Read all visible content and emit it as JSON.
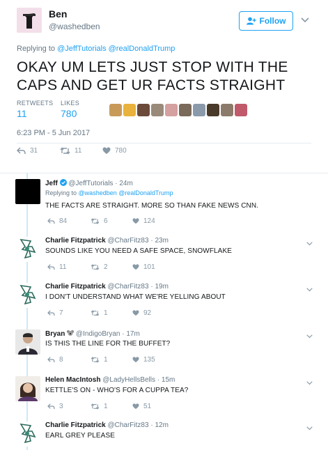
{
  "main_tweet": {
    "name": "Ben",
    "handle": "@washedben",
    "follow_label": "Follow",
    "replying_prefix": "Replying to",
    "replying_to": "@JeffTutorials @realDonaldTrump",
    "text": "OKAY UM LETS JUST STOP WITH THE CAPS AND GET UR FACTS STRAIGHT",
    "retweets_label": "RETWEETS",
    "retweets_count": "11",
    "likes_label": "LIKES",
    "likes_count": "780",
    "timestamp": "6:23 PM - 5 Jun 2017",
    "action_reply_count": "31",
    "action_retweet_count": "11",
    "action_like_count": "780",
    "liker_colors": [
      "#c89a5a",
      "#e9b23c",
      "#6b4a3a",
      "#9a8a7a",
      "#d4a0a0",
      "#7a6a5a",
      "#8a9aaa",
      "#4a3a2a",
      "#8c7b6a",
      "#c05a6a"
    ]
  },
  "replies": [
    {
      "name": "Jeff",
      "verified": true,
      "handle": "@JeffTutorials",
      "time": "24m",
      "replying_prefix": "Replying to",
      "replying_to": "@washedben @realDonaldTrump",
      "text": "THE FACTS ARE STRAIGHT. MORE SO THAN FAKE NEWS CNN.",
      "reply_count": "84",
      "retweet_count": "6",
      "like_count": "124"
    },
    {
      "name": "Charlie Fitzpatrick",
      "handle": "@CharFitz83",
      "time": "23m",
      "text": "SOUNDS LIKE YOU NEED A SAFE SPACE, SNOWFLAKE",
      "reply_count": "11",
      "retweet_count": "2",
      "like_count": "101"
    },
    {
      "name": "Charlie Fitzpatrick",
      "handle": "@CharFitz83",
      "time": "19m",
      "text": "I DON'T UNDERSTAND WHAT WE'RE YELLING ABOUT",
      "reply_count": "7",
      "retweet_count": "1",
      "like_count": "92"
    },
    {
      "name": "Bryan",
      "handle": "@IndigoBryan",
      "time": "17m",
      "text": "IS THIS THE LINE FOR THE BUFFET?",
      "reply_count": "8",
      "retweet_count": "1",
      "like_count": "135"
    },
    {
      "name": "Helen MacIntosh",
      "handle": "@LadyHellsBells",
      "time": "15m",
      "text": "KETTLE'S ON - WHO'S FOR A CUPPA TEA?",
      "reply_count": "3",
      "retweet_count": "1",
      "like_count": "51"
    },
    {
      "name": "Charlie Fitzpatrick",
      "handle": "@CharFitz83",
      "time": "12m",
      "text": "EARL GREY PLEASE"
    }
  ],
  "colors": {
    "accent": "#1da1f2",
    "meta": "#657786",
    "thread_line": "#cfe8f7"
  }
}
